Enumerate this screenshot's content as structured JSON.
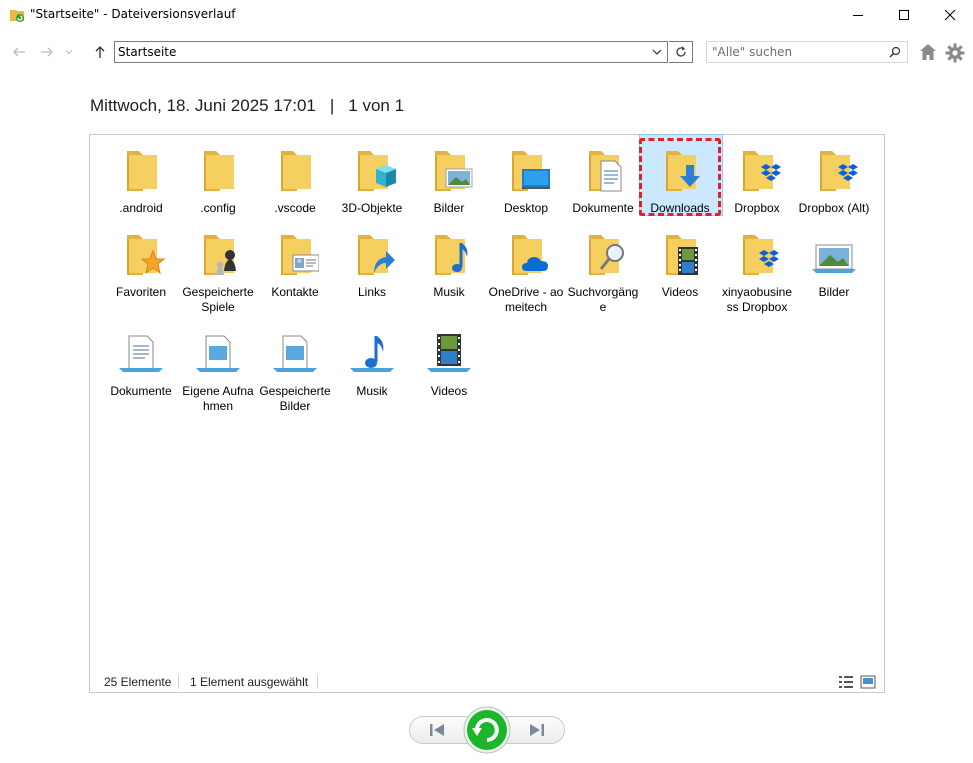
{
  "window": {
    "title": "\"Startseite\" - Dateiversionsverlauf"
  },
  "nav": {
    "address": "Startseite",
    "search_placeholder": "\"Alle\" suchen"
  },
  "heading": {
    "date": "Mittwoch, 18. Juni 2025 17:01",
    "separator": "|",
    "position": "1 von 1"
  },
  "items_row1": [
    {
      "label": ".android",
      "icon": "folder-icon"
    },
    {
      "label": ".config",
      "icon": "folder-icon"
    },
    {
      "label": ".vscode",
      "icon": "folder-icon"
    },
    {
      "label": "3D-Objekte",
      "icon": "folder-3d-objects-icon"
    },
    {
      "label": "Bilder",
      "icon": "folder-pictures-icon"
    },
    {
      "label": "Desktop",
      "icon": "folder-desktop-icon"
    },
    {
      "label": "Dokumente",
      "icon": "folder-documents-icon"
    },
    {
      "label": "Downloads",
      "icon": "folder-downloads-icon"
    },
    {
      "label": "Dropbox",
      "icon": "folder-dropbox-icon"
    },
    {
      "label": "Dropbox (Alt)",
      "icon": "folder-dropbox-icon"
    }
  ],
  "items_row2": [
    {
      "label": "Favoriten",
      "icon": "folder-favorites-icon"
    },
    {
      "label": "Gespeicherte Spiele",
      "icon": "folder-saved-games-icon"
    },
    {
      "label": "Kontakte",
      "icon": "folder-contacts-icon"
    },
    {
      "label": "Links",
      "icon": "folder-links-icon"
    },
    {
      "label": "Musik",
      "icon": "folder-music-icon"
    },
    {
      "label": "OneDrive - aomeitech",
      "icon": "folder-onedrive-icon"
    },
    {
      "label": "Suchvorgänge",
      "icon": "folder-searches-icon"
    },
    {
      "label": "Videos",
      "icon": "folder-videos-icon"
    },
    {
      "label": "xinyaobusiness Dropbox",
      "icon": "folder-dropbox-icon"
    },
    {
      "label": "Bilder",
      "icon": "pictures-library-icon"
    }
  ],
  "items_row3": [
    {
      "label": "Dokumente",
      "icon": "documents-library-icon"
    },
    {
      "label": "Eigene Aufnahmen",
      "icon": "recordings-library-icon"
    },
    {
      "label": "Gespeicherte Bilder",
      "icon": "saved-pictures-library-icon"
    },
    {
      "label": "Musik",
      "icon": "music-library-icon"
    },
    {
      "label": "Videos",
      "icon": "videos-library-icon"
    }
  ],
  "selected_label": "Downloads",
  "status": {
    "count": "25 Elemente",
    "selection": "1 Element ausgewählt"
  },
  "colors": {
    "folder": "#f5cf5f",
    "folder_dark": "#e3b23c",
    "selection_bg": "#cce8ff",
    "selection_border": "#99c9ef",
    "highlight": "#e0202a",
    "restore_green": "#1db52a"
  }
}
